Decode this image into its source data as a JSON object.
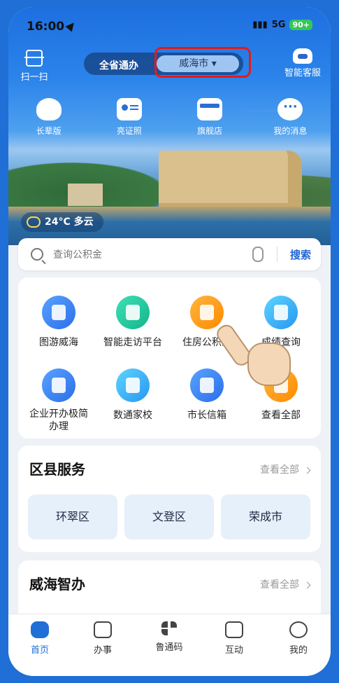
{
  "status_bar": {
    "time": "16:00",
    "network": "5G",
    "battery": "90+"
  },
  "top_bar": {
    "scan_label": "扫一扫",
    "toggle_left": "全省通办",
    "city_selector": "威海市",
    "service_label": "智能客服"
  },
  "quick_actions": [
    {
      "label": "长辈版",
      "icon": "heart-hand-icon"
    },
    {
      "label": "亮证照",
      "icon": "id-card-icon"
    },
    {
      "label": "旗舰店",
      "icon": "store-icon"
    },
    {
      "label": "我的消息",
      "icon": "message-icon"
    }
  ],
  "weather": {
    "text": "24°C 多云"
  },
  "search": {
    "placeholder": "查询公积金",
    "button": "搜索"
  },
  "services": [
    {
      "label": "图游威海",
      "color": "#2a6fe8",
      "badge": "图游\n威海"
    },
    {
      "label": "智能走访平台",
      "color": "#13b58c"
    },
    {
      "label": "住房公积金",
      "color": "#ff8a00"
    },
    {
      "label": "成绩查询",
      "color": "#2797f0"
    },
    {
      "label": "企业开办极简办理",
      "color": "#2a6fe8"
    },
    {
      "label": "数通家校",
      "color": "#2797f0"
    },
    {
      "label": "市长信箱",
      "color": "#2a6fe8"
    },
    {
      "label": "查看全部",
      "color": "#ff8a00"
    }
  ],
  "district": {
    "title": "区县服务",
    "more": "查看全部",
    "items": [
      "环翠区",
      "文登区",
      "荣成市"
    ]
  },
  "smart": {
    "title": "威海智办",
    "more": "查看全部"
  },
  "nav": [
    {
      "label": "首页",
      "active": true
    },
    {
      "label": "办事"
    },
    {
      "label": "鲁通码"
    },
    {
      "label": "互动"
    },
    {
      "label": "我的"
    }
  ]
}
